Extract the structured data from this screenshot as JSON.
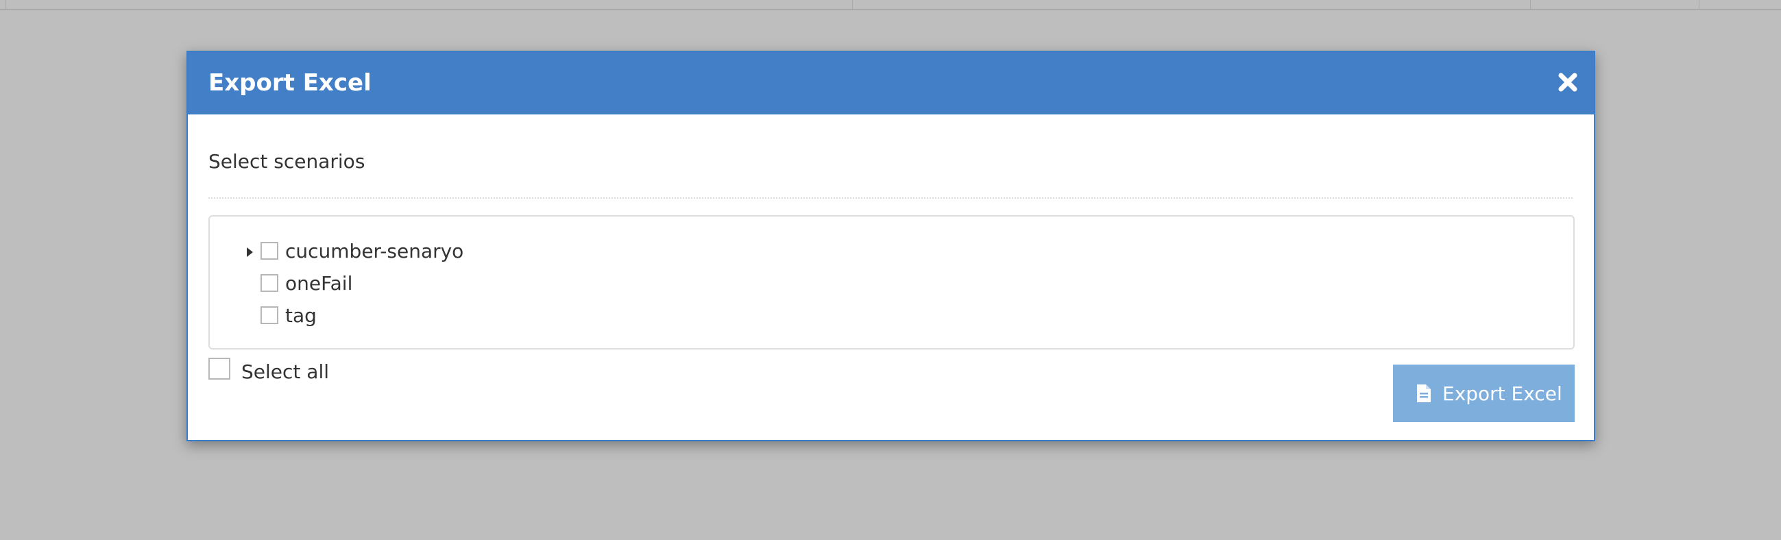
{
  "modal": {
    "title": "Export Excel",
    "close_icon": "close-icon",
    "section_label": "Select scenarios",
    "tree": [
      {
        "label": "cucumber-senaryo",
        "expandable": true,
        "checked": false
      },
      {
        "label": "oneFail",
        "expandable": false,
        "checked": false
      },
      {
        "label": "tag",
        "expandable": false,
        "checked": false
      }
    ],
    "select_all": {
      "label": "Select all",
      "checked": false
    },
    "export_button": {
      "label": "Export Excel",
      "icon": "file-icon"
    }
  },
  "colors": {
    "header": "#437fc7",
    "button": "#7eaedc",
    "overlay": "#bebebe"
  }
}
